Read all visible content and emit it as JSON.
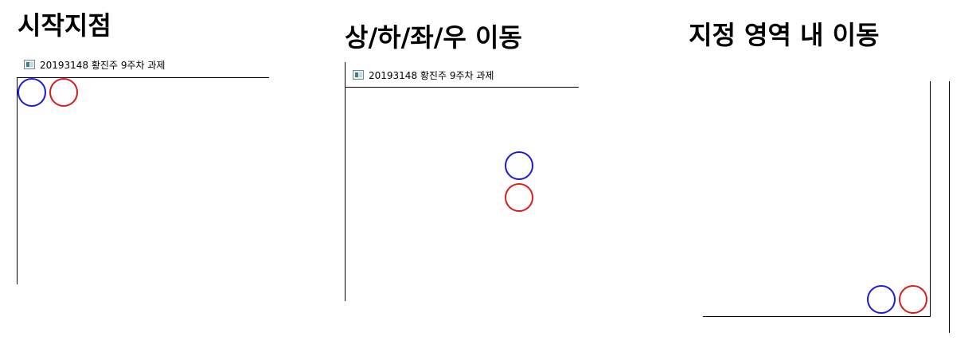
{
  "panels": [
    {
      "heading": "시작지점",
      "window_title": "20193148 황진주 9주차 과제",
      "window_icon": "app-window-icon"
    },
    {
      "heading": "상/하/좌/우 이동",
      "window_title": "20193148 황진주 9주차 과제",
      "window_icon": "app-window-icon"
    },
    {
      "heading": "지정 영역 내 이동",
      "window_icon": "none"
    }
  ],
  "colors": {
    "blue_circle": "#1b1bd6",
    "red_circle": "#d81c1c",
    "background": "#ffffff",
    "border": "#000000"
  }
}
